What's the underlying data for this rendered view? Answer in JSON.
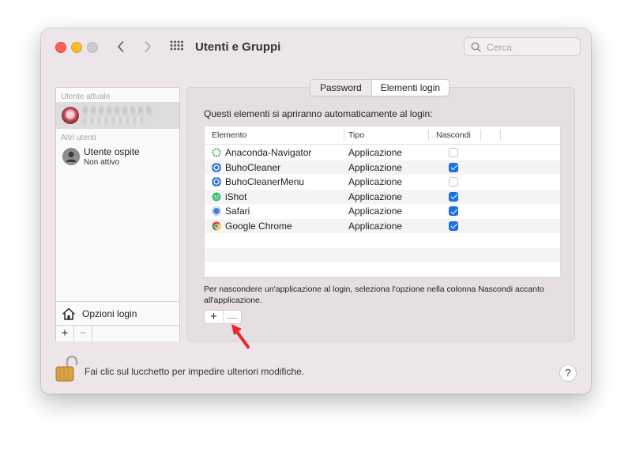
{
  "window": {
    "title": "Utenti e Gruppi",
    "search_placeholder": "Cerca"
  },
  "sidebar": {
    "current_user_section": "Utente attuale",
    "other_users_section": "Altri utenti",
    "guest": {
      "name": "Utente ospite",
      "status": "Non attivo"
    },
    "login_options_label": "Opzioni login",
    "add_label": "+",
    "remove_label": "−"
  },
  "tabs": {
    "password": "Password",
    "login_items": "Elementi login"
  },
  "main": {
    "intro": "Questi elementi si apriranno automaticamente al login:",
    "columns": {
      "item": "Elemento",
      "type": "Tipo",
      "hide": "Nascondi"
    },
    "rows": [
      {
        "name": "Anaconda-Navigator",
        "type": "Applicazione",
        "hide": false,
        "icon": "anaconda-icon"
      },
      {
        "name": "BuhoCleaner",
        "type": "Applicazione",
        "hide": true,
        "icon": "buhocleaner-icon"
      },
      {
        "name": "BuhoCleanerMenu",
        "type": "Applicazione",
        "hide": false,
        "icon": "buhocleanermenu-icon"
      },
      {
        "name": "iShot",
        "type": "Applicazione",
        "hide": true,
        "icon": "ishot-icon"
      },
      {
        "name": "Safari",
        "type": "Applicazione",
        "hide": true,
        "icon": "safari-icon"
      },
      {
        "name": "Google Chrome",
        "type": "Applicazione",
        "hide": true,
        "icon": "chrome-icon"
      }
    ],
    "hint": "Per nascondere un'applicazione al login, seleziona l'opzione nella colonna Nascondi accanto all'applicazione.",
    "add_label": "+",
    "remove_label": "—"
  },
  "footer": {
    "lock_text": "Fai clic sul lucchetto per impedire ulteriori modifiche.",
    "help_label": "?"
  },
  "colors": {
    "accent": "#1a73e8",
    "arrow": "#e8262b"
  }
}
